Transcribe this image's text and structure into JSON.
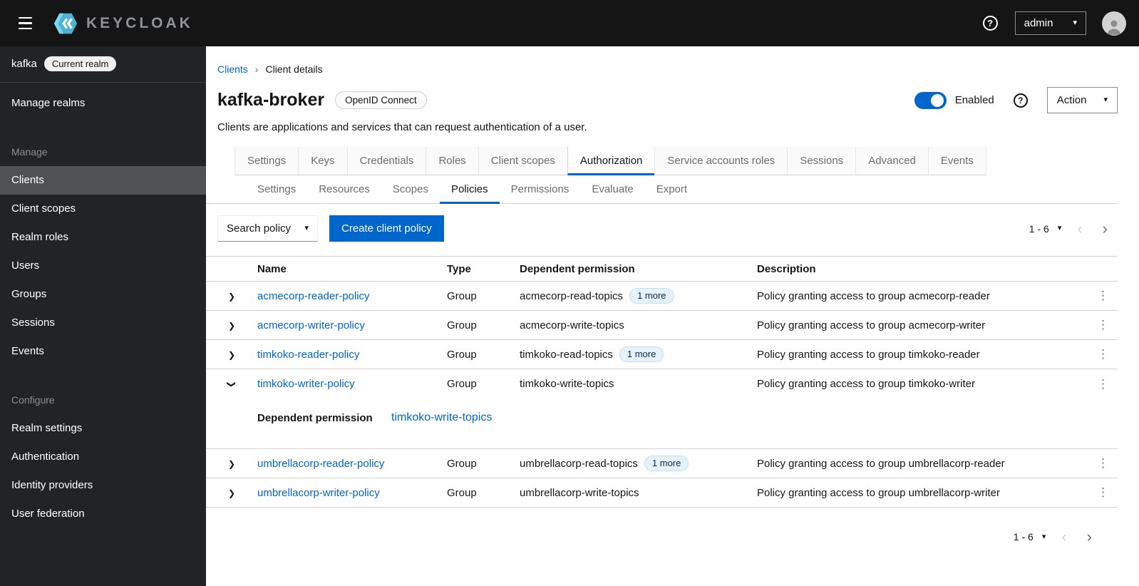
{
  "icons": {
    "caret_down": "▾",
    "chevron_right": "❯",
    "chevron_left_nav": "‹",
    "chevron_right_nav": "›",
    "breadcrumb_sep": "›",
    "kebab": "⋮",
    "question_mark": "?"
  },
  "colors": {
    "primary_blue": "#0066cc",
    "topbar_bg": "#151515",
    "sidebar_bg": "#212427",
    "sidebar_selected_bg": "#4f5255",
    "link": "#0066cc",
    "border": "#d2d2d2",
    "badge_blue_bg": "#e7f1fa"
  },
  "topbar": {
    "brand": "KEYCLOAK",
    "username": "admin"
  },
  "sidebar": {
    "realm_name": "kafka",
    "realm_badge": "Current realm",
    "manage_realms": "Manage realms",
    "selected_item": "Clients",
    "sections": [
      {
        "header": "Manage",
        "items": [
          "Clients",
          "Client scopes",
          "Realm roles",
          "Users",
          "Groups",
          "Sessions",
          "Events"
        ]
      },
      {
        "header": "Configure",
        "items": [
          "Realm settings",
          "Authentication",
          "Identity providers",
          "User federation"
        ]
      }
    ]
  },
  "breadcrumb": {
    "items": [
      "Clients",
      "Client details"
    ]
  },
  "page_header": {
    "title": "kafka-broker",
    "protocol_badge": "OpenID Connect",
    "enabled": true,
    "enabled_label": "Enabled",
    "action_label": "Action",
    "description": "Clients are applications and services that can request authentication of a user."
  },
  "tabs": {
    "main": [
      "Settings",
      "Keys",
      "Credentials",
      "Roles",
      "Client scopes",
      "Authorization",
      "Service accounts roles",
      "Sessions",
      "Advanced",
      "Events"
    ],
    "main_selected": "Authorization",
    "sub": [
      "Settings",
      "Resources",
      "Scopes",
      "Policies",
      "Permissions",
      "Evaluate",
      "Export"
    ],
    "sub_selected": "Policies"
  },
  "toolbar": {
    "search_label": "Search policy",
    "create_button": "Create client policy"
  },
  "pagination": {
    "range": "1 - 6"
  },
  "table": {
    "headers": {
      "name": "Name",
      "type": "Type",
      "dependent": "Dependent permission",
      "description": "Description"
    },
    "rows": [
      {
        "name": "acmecorp-reader-policy",
        "type": "Group",
        "dependent": "acmecorp-read-topics",
        "more_badge": "1 more",
        "description": "Policy granting access to group acmecorp-reader",
        "expanded": false
      },
      {
        "name": "acmecorp-writer-policy",
        "type": "Group",
        "dependent": "acmecorp-write-topics",
        "description": "Policy granting access to group acmecorp-writer",
        "expanded": false
      },
      {
        "name": "timkoko-reader-policy",
        "type": "Group",
        "dependent": "timkoko-read-topics",
        "more_badge": "1 more",
        "description": "Policy granting access to group timkoko-reader",
        "expanded": false
      },
      {
        "name": "timkoko-writer-policy",
        "type": "Group",
        "dependent": "timkoko-write-topics",
        "description": "Policy granting access to group timkoko-writer",
        "expanded": true,
        "expansion": {
          "label": "Dependent permission",
          "link": "timkoko-write-topics"
        }
      },
      {
        "name": "umbrellacorp-reader-policy",
        "type": "Group",
        "dependent": "umbrellacorp-read-topics",
        "more_badge": "1 more",
        "description": "Policy granting access to group umbrellacorp-reader",
        "expanded": false
      },
      {
        "name": "umbrellacorp-writer-policy",
        "type": "Group",
        "dependent": "umbrellacorp-write-topics",
        "description": "Policy granting access to group umbrellacorp-writer",
        "expanded": false
      }
    ]
  }
}
